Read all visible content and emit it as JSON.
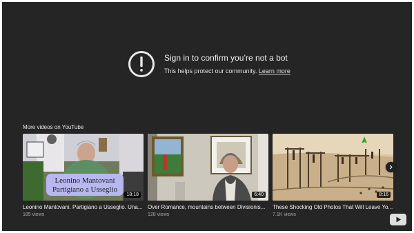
{
  "bot_check": {
    "title": "Sign in to confirm you’re not a bot",
    "subtitle": "This helps protect our community.",
    "learn_more": "Learn more"
  },
  "more_videos": {
    "label": "More videos on YouTube",
    "videos": [
      {
        "title": "Leonino Mantovani. Partigiano a Usseglio. Una...",
        "views": "185 views",
        "duration": "18:18",
        "thumb_caption_line1": "Leonino Mantovani",
        "thumb_caption_line2": "Partigiano a Usseglio"
      },
      {
        "title": "Over Romance, mountains between Divisionis...",
        "views": "128 views",
        "duration": "6:40"
      },
      {
        "title": "These Shocking Old Photos That Will Leave Yo...",
        "views": "7.1K views",
        "duration": "8:16"
      }
    ]
  },
  "icons": {
    "alert": "exclamation-circle-icon",
    "next": "chevron-right-icon",
    "logo": "youtube-logo-icon"
  },
  "colors": {
    "background": "#252525",
    "text": "#f1f1f1",
    "muted": "#aaaaaa",
    "caption_bg": "#b7b8f0"
  }
}
